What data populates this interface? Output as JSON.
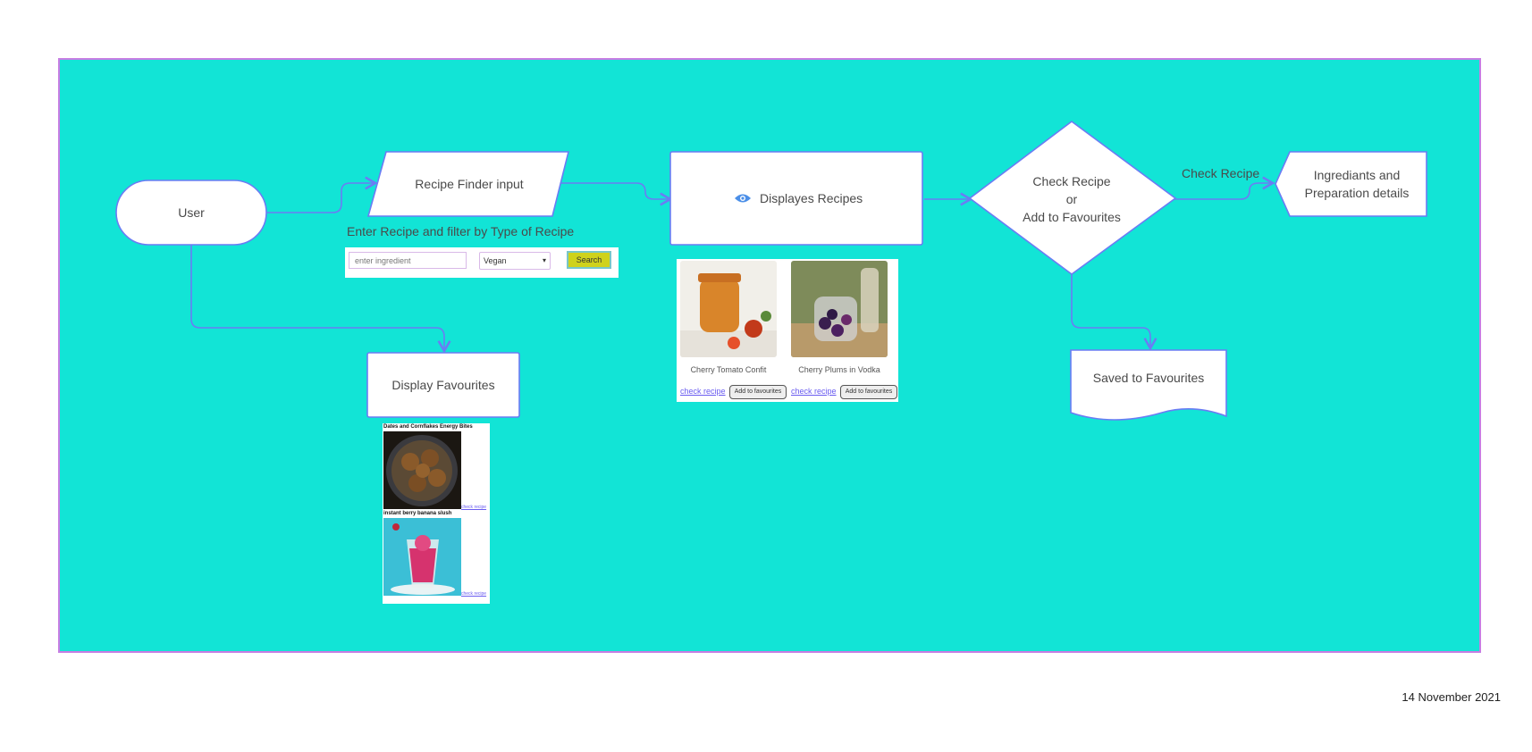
{
  "diagram": {
    "nodes": {
      "user": "User",
      "recipe_finder_input": "Recipe Finder input",
      "displays_recipes": "Displayes Recipes",
      "check_recipe_decision": [
        "Check Recipe",
        "or",
        "Add to Favourites"
      ],
      "ingredients_details": [
        "Ingrediants and",
        "Preparation details"
      ],
      "saved_to_favourites": "Saved to Favourites",
      "display_favourites": "Display Favourites"
    },
    "edge_labels": {
      "check_recipe": "Check Recipe"
    },
    "annotations": {
      "filter_caption": "Enter Recipe and filter by Type of Recipe"
    }
  },
  "search_widget": {
    "placeholder": "enter ingredient",
    "select_value": "Vegan",
    "button_label": "Search"
  },
  "recipe_cards": [
    {
      "title": "Cherry Tomato Confit",
      "link": "check recipe",
      "button": "Add to favourites"
    },
    {
      "title": "Cherry Plums in Vodka",
      "link": "check recipe",
      "button": "Add to favourites"
    }
  ],
  "favourites": [
    {
      "title": "Dates and Cornflakes Energy Bites",
      "link": "check recipe"
    },
    {
      "title": "instant berry banana slush",
      "link": "check recipe"
    }
  ],
  "footer": {
    "date": "14 November 2021"
  },
  "colors": {
    "background": "#12e4d6",
    "border": "#c77de3",
    "connector": "#6b7cf4",
    "node_fill": "#ffffff"
  }
}
